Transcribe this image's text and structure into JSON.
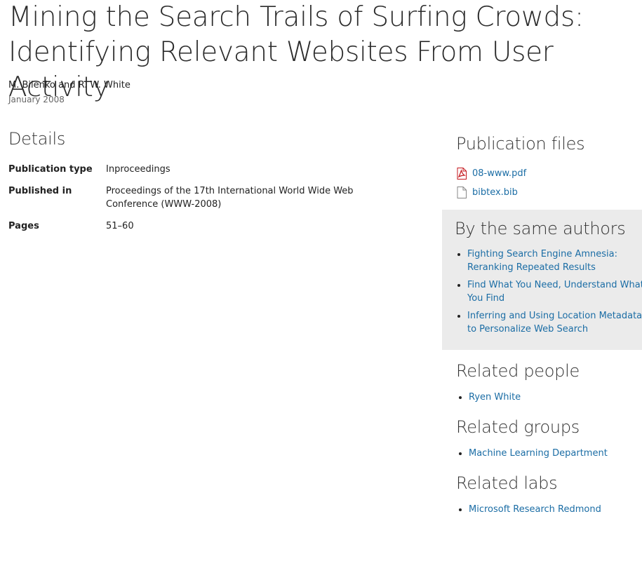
{
  "title": "Mining the Search Trails of Surfing Crowds: Identifying Relevant Websites From User Activity",
  "authors": "M. Bilenko and R. W. White",
  "date": "January 2008",
  "details": {
    "heading": "Details",
    "rows": [
      {
        "label": "Publication type",
        "value": "Inproceedings"
      },
      {
        "label": "Published in",
        "value": "Proceedings of the 17th International World Wide Web Conference (WWW-2008)"
      },
      {
        "label": "Pages",
        "value": "51–60"
      }
    ]
  },
  "publication_files": {
    "heading": "Publication files",
    "files": [
      {
        "name": "08-www.pdf",
        "icon": "pdf-file-icon"
      },
      {
        "name": "bibtex.bib",
        "icon": "document-file-icon"
      }
    ]
  },
  "same_authors": {
    "heading": "By the same authors",
    "items": [
      "Fighting Search Engine Amnesia: Reranking Repeated Results",
      "Find What You Need, Understand What You Find",
      "Inferring and Using Location Metadata to Personalize Web Search"
    ]
  },
  "related_people": {
    "heading": "Related people",
    "items": [
      "Ryen White"
    ]
  },
  "related_groups": {
    "heading": "Related groups",
    "items": [
      "Machine Learning Department"
    ]
  },
  "related_labs": {
    "heading": "Related labs",
    "items": [
      "Microsoft Research Redmond"
    ]
  },
  "colors": {
    "link": "#1b6da5",
    "sidebar_box": "#ebebeb",
    "pdf_icon": "#c4161c"
  }
}
